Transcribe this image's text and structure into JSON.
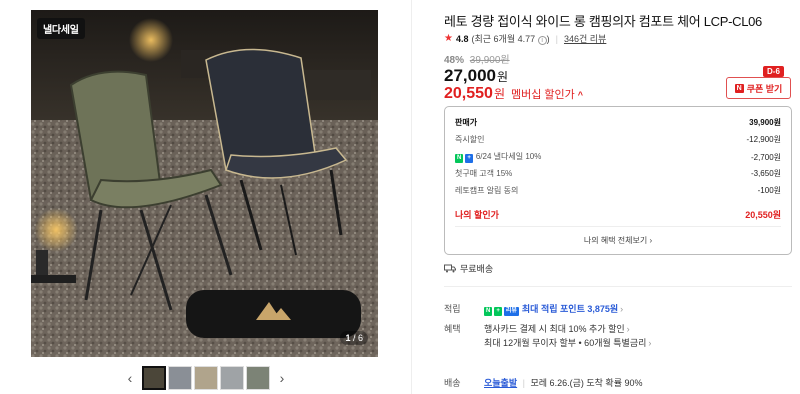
{
  "gallery": {
    "tag": "낼다세일",
    "counter_current": "1",
    "counter_total": "6",
    "prev_icon": "chevron-left-icon",
    "next_icon": "chevron-right-icon",
    "thumb_count": 5
  },
  "product": {
    "title": "레토 경량 접이식 와이드 롱 캠핑의자 컴포트 체어 LCP-CL06",
    "rating": "4.8",
    "rating_detail": "(최근 6개월 4.77",
    "rating_close": ")",
    "reviews": "346건 리뷰",
    "discount_pct": "48%",
    "original_price": "39,900원",
    "price": "27,000",
    "price_unit": "원",
    "member_price": "20,550",
    "member_price_unit": "원",
    "member_label": "멤버십 할인가",
    "coupon_label": "쿠폰 받기",
    "coupon_icon": "N",
    "dday": "D-6"
  },
  "breakdown": {
    "rows": [
      {
        "label": "판매가",
        "value": "39,900원"
      },
      {
        "label": "즉시할인",
        "value": "-12,900원"
      },
      {
        "label": "6/24 낼다세일 10%",
        "value": "-2,700원"
      },
      {
        "label": "첫구매 고객 15%",
        "value": "-3,650원"
      },
      {
        "label": "레토캠프 알림 동의",
        "value": "-100원"
      }
    ],
    "npay_badge": "N",
    "plus_badge": "+",
    "total_label": "나의 할인가",
    "total_value": "20,550원",
    "view_all": "나의 혜택 전체보기"
  },
  "shipping": {
    "label": "무료배송"
  },
  "points": {
    "label": "적립",
    "badge_n": "N",
    "badge_plus": "+",
    "badge_text": "리뷰",
    "text": "최대 적립 포인트 3,875원"
  },
  "benefits": {
    "label": "혜택",
    "line1": "행사카드 결제 시 최대 10% 추가 할인",
    "line2": "최대 12개월 무이자 할부 • 60개월 특별금리"
  },
  "delivery": {
    "label": "배송",
    "today": "오늘출발",
    "text": "모레 6.26.(금) 도착 확률 90%"
  },
  "colors": {
    "accent_red": "#e02020",
    "naver_green": "#03c75a",
    "point_blue": "#2a5bd7"
  }
}
